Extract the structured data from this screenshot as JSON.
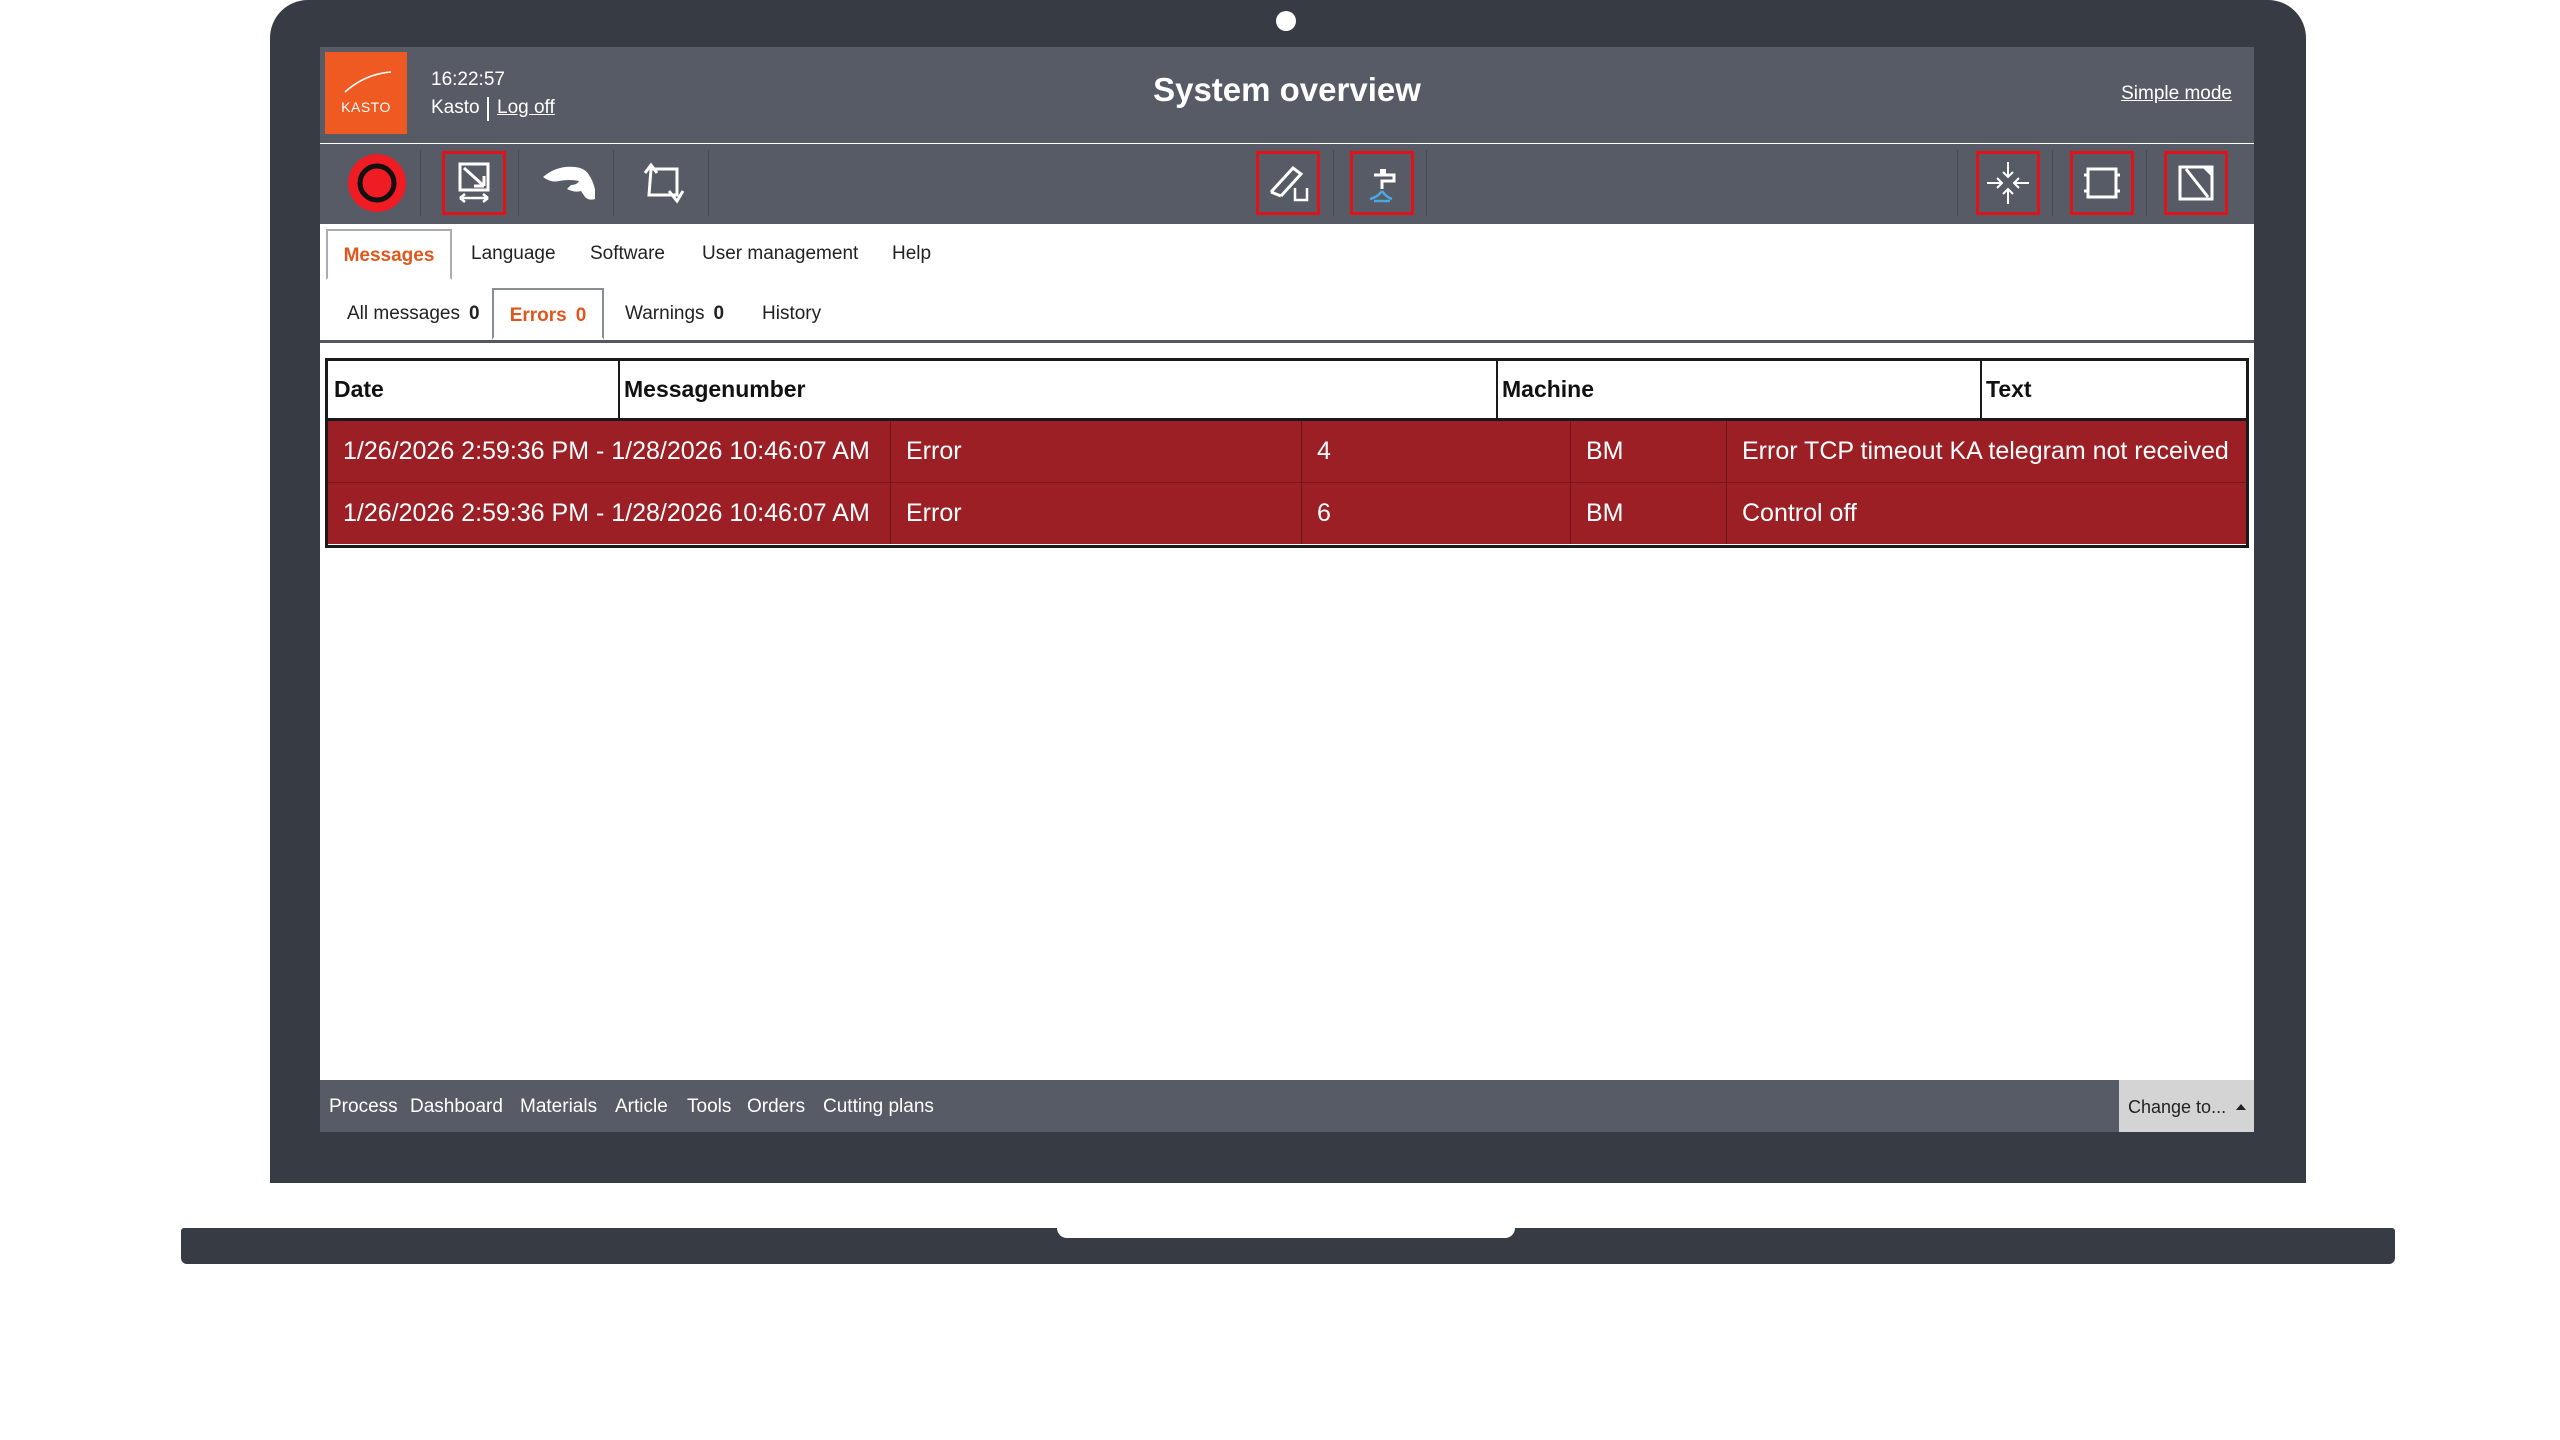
{
  "header": {
    "logo_text": "KASTO",
    "time": "16:22:57",
    "user": "Kasto",
    "logoff": "Log off",
    "title": "System overview",
    "simple_mode": "Simple mode"
  },
  "toolbar": {
    "icons": [
      "stop-icon",
      "saw-feed-icon",
      "hand-manual-icon",
      "cycle-icon",
      "cut-angle-icon",
      "coolant-icon",
      "center-clamp-icon",
      "material-frame-icon",
      "diagonal-frame-icon"
    ],
    "accent": "#e0121b"
  },
  "main_tabs": [
    {
      "label": "Messages",
      "active": true
    },
    {
      "label": "Language"
    },
    {
      "label": "Software"
    },
    {
      "label": "User management"
    },
    {
      "label": "Help"
    }
  ],
  "sub_tabs": [
    {
      "label": "All messages",
      "count": "0"
    },
    {
      "label": "Errors",
      "count": "0",
      "active": true
    },
    {
      "label": "Warnings",
      "count": "0"
    },
    {
      "label": "History"
    }
  ],
  "table": {
    "columns": [
      "Date",
      "Messagenumber",
      "Machine",
      "Text"
    ],
    "rows": [
      {
        "date": "1/26/2026 2:59:36 PM - 1/28/2026 10:46:07 AM",
        "type": "Error",
        "number": "4",
        "machine": "BM",
        "text": "Error TCP timeout KA telegram not received"
      },
      {
        "date": "1/26/2026 2:59:36 PM - 1/28/2026 10:46:07 AM",
        "type": "Error",
        "number": "6",
        "machine": "BM",
        "text": "Control off"
      }
    ],
    "row_color": "#9b1f24"
  },
  "footer": {
    "links": [
      "Process",
      "Dashboard",
      "Materials",
      "Article",
      "Tools",
      "Orders",
      "Cutting plans"
    ],
    "change_to": "Change to..."
  },
  "colors": {
    "brand": "#ef5a22",
    "header_bg": "#565b66",
    "active_tab": "#e0561c"
  }
}
